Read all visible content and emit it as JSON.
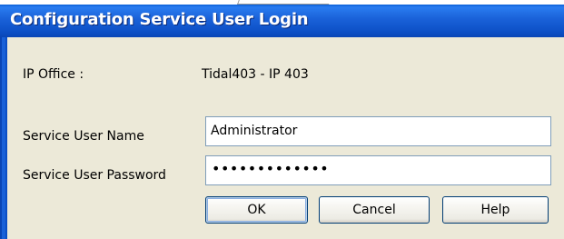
{
  "window": {
    "title": "Configuration Service User Login"
  },
  "form": {
    "ip_office_label": "IP Office :",
    "ip_office_value": "Tidal403 - IP 403",
    "user_name_label": "Service User Name",
    "user_name_value": "Administrator",
    "password_label": "Service User Password",
    "password_mask": "•••••••••••••"
  },
  "buttons": {
    "ok": "OK",
    "cancel": "Cancel",
    "help": "Help"
  },
  "colors": {
    "title_bar": "#1961d8",
    "dialog_bg": "#ece9d8",
    "field_border": "#7f9db9",
    "button_border": "#003c74"
  }
}
